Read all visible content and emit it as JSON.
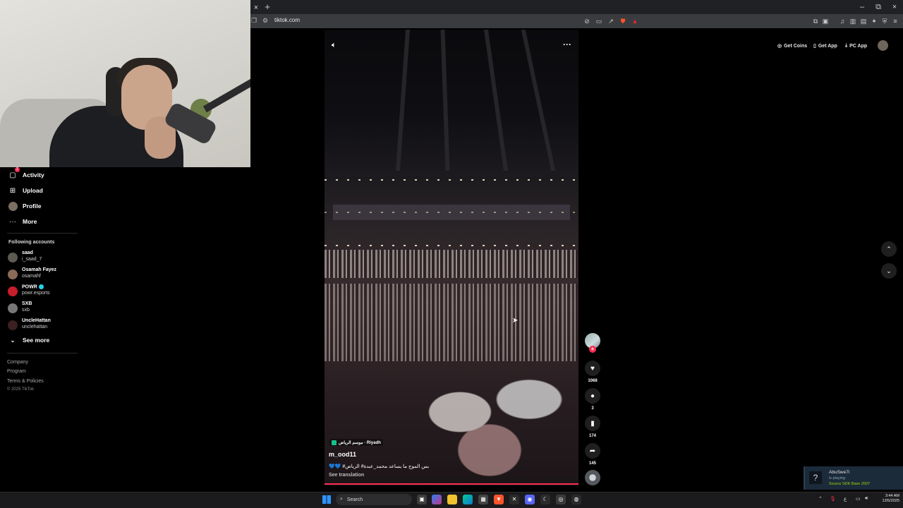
{
  "browser": {
    "tab_close": "×",
    "new_tab": "+",
    "url": "tiktok.com",
    "window_controls": {
      "minimize": "–",
      "restore": "⧉",
      "close": "×"
    }
  },
  "sidebar": {
    "nav": [
      {
        "label": "Activity",
        "icon": "activity-icon",
        "badge": "1"
      },
      {
        "label": "Upload",
        "icon": "upload-icon"
      },
      {
        "label": "Profile",
        "icon": "profile-avatar"
      },
      {
        "label": "More",
        "icon": "more-icon"
      }
    ],
    "following_title": "Following accounts",
    "following": [
      {
        "name": "saad",
        "handle": "i_saad_7"
      },
      {
        "name": "Osamah Fayez",
        "handle": "osamahf"
      },
      {
        "name": "POWR",
        "handle": "powr.esports",
        "verified": true
      },
      {
        "name": "SXB",
        "handle": "sxb"
      },
      {
        "name": "UncleHattan",
        "handle": "unclehattan"
      }
    ],
    "see_more": "See more",
    "footer_links": [
      "Company",
      "Program",
      "Terms & Policies"
    ],
    "copyright": "© 2025 TikTok"
  },
  "header": {
    "get_coins": "Get Coins",
    "get_app": "Get App",
    "pc_app": "PC App"
  },
  "video": {
    "location": "موسم الرياض · Riyadh",
    "author": "m_ood11",
    "caption": "بس الموج ما يساعد محمد_عبدة# الرياض# 💙💙",
    "see_translation": "See translation",
    "likes": "1068",
    "comments": "3",
    "saves": "174",
    "shares": "145",
    "progress": 1.0
  },
  "steam_popup": {
    "user": "AbuSwe7i",
    "status": "is playing",
    "game": "Source SDK Base 2007"
  },
  "taskbar": {
    "search_placeholder": "Search",
    "time": "3:44 AM",
    "date": "12/5/2025",
    "lang": "ع"
  },
  "colors": {
    "accent": "#fe2c55",
    "background": "#000000",
    "verified": "#20d5ec"
  }
}
